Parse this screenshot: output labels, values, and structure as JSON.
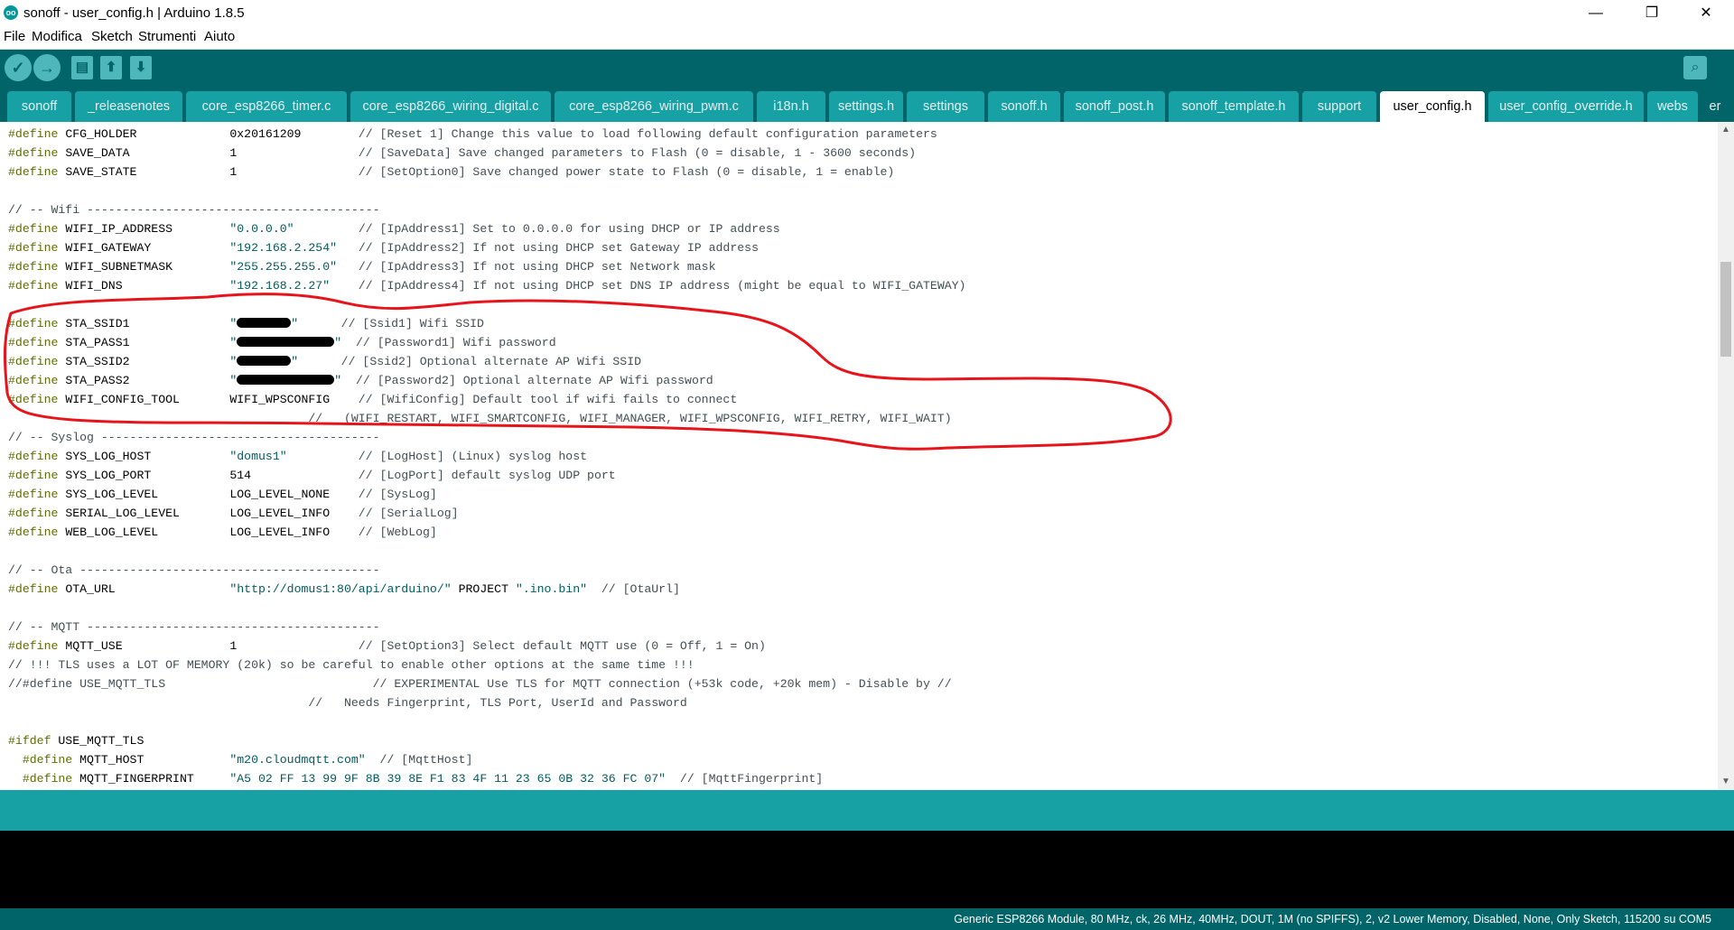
{
  "window": {
    "title": "sonoff - user_config.h | Arduino 1.8.5",
    "app_icon_glyph": "oo",
    "minimize": "—",
    "maximize": "❐",
    "close": "✕"
  },
  "menu": [
    "File",
    "Modifica",
    "Sketch",
    "Strumenti",
    "Aiuto"
  ],
  "toolbar": {
    "verify_icon": "✓",
    "upload_icon": "→",
    "new_icon": "▤",
    "open_icon": "⬆",
    "save_icon": "⬇",
    "serial_icon": "⌕"
  },
  "tabs": [
    "sonoff",
    "_releasenotes",
    "core_esp8266_timer.c",
    "core_esp8266_wiring_digital.c",
    "core_esp8266_wiring_pwm.c",
    "i18n.h",
    "settings.h",
    "settings",
    "sonoff.h",
    "sonoff_post.h",
    "sonoff_template.h",
    "support",
    "user_config.h",
    "user_config_override.h",
    "webs",
    "er"
  ],
  "active_tab": "user_config.h",
  "code_lines": [
    [
      [
        "kw",
        "#define"
      ],
      [
        "t",
        " CFG_HOLDER             0x20161209        "
      ],
      [
        "cm",
        "// [Reset 1] Change this value to load following default configuration parameters"
      ]
    ],
    [
      [
        "kw",
        "#define"
      ],
      [
        "t",
        " SAVE_DATA              1                 "
      ],
      [
        "cm",
        "// [SaveData] Save changed parameters to Flash (0 = disable, 1 - 3600 seconds)"
      ]
    ],
    [
      [
        "kw",
        "#define"
      ],
      [
        "t",
        " SAVE_STATE             1                 "
      ],
      [
        "cm",
        "// [SetOption0] Save changed power state to Flash (0 = disable, 1 = enable)"
      ]
    ],
    [],
    [
      [
        "cm",
        "// -- Wifi -----------------------------------------"
      ]
    ],
    [
      [
        "kw",
        "#define"
      ],
      [
        "t",
        " WIFI_IP_ADDRESS        "
      ],
      [
        "str",
        "\"0.0.0.0\""
      ],
      [
        "t",
        "         "
      ],
      [
        "cm",
        "// [IpAddress1] Set to 0.0.0.0 for using DHCP or IP address"
      ]
    ],
    [
      [
        "kw",
        "#define"
      ],
      [
        "t",
        " WIFI_GATEWAY           "
      ],
      [
        "str",
        "\"192.168.2.254\""
      ],
      [
        "t",
        "   "
      ],
      [
        "cm",
        "// [IpAddress2] If not using DHCP set Gateway IP address"
      ]
    ],
    [
      [
        "kw",
        "#define"
      ],
      [
        "t",
        " WIFI_SUBNETMASK        "
      ],
      [
        "str",
        "\"255.255.255.0\""
      ],
      [
        "t",
        "   "
      ],
      [
        "cm",
        "// [IpAddress3] If not using DHCP set Network mask"
      ]
    ],
    [
      [
        "kw",
        "#define"
      ],
      [
        "t",
        " WIFI_DNS               "
      ],
      [
        "str",
        "\"192.168.2.27\""
      ],
      [
        "t",
        "    "
      ],
      [
        "cm",
        "// [IpAddress4] If not using DHCP set DNS IP address (might be equal to WIFI_GATEWAY)"
      ]
    ],
    [],
    [
      [
        "kw",
        "#define"
      ],
      [
        "t",
        " STA_SSID1              "
      ],
      [
        "str",
        "\""
      ],
      [
        "r",
        "60"
      ],
      [
        "str",
        "\""
      ],
      [
        "t",
        "      "
      ],
      [
        "cm",
        "// [Ssid1] Wifi SSID"
      ]
    ],
    [
      [
        "kw",
        "#define"
      ],
      [
        "t",
        " STA_PASS1              "
      ],
      [
        "str",
        "\""
      ],
      [
        "r",
        "108"
      ],
      [
        "str",
        "\""
      ],
      [
        "t",
        "  "
      ],
      [
        "cm",
        "// [Password1] Wifi password"
      ]
    ],
    [
      [
        "kw",
        "#define"
      ],
      [
        "t",
        " STA_SSID2              "
      ],
      [
        "str",
        "\""
      ],
      [
        "r",
        "60"
      ],
      [
        "str",
        "\""
      ],
      [
        "t",
        "      "
      ],
      [
        "cm",
        "// [Ssid2] Optional alternate AP Wifi SSID"
      ]
    ],
    [
      [
        "kw",
        "#define"
      ],
      [
        "t",
        " STA_PASS2              "
      ],
      [
        "str",
        "\""
      ],
      [
        "r",
        "108"
      ],
      [
        "str",
        "\""
      ],
      [
        "t",
        "  "
      ],
      [
        "cm",
        "// [Password2] Optional alternate AP Wifi password"
      ]
    ],
    [
      [
        "kw",
        "#define"
      ],
      [
        "t",
        " WIFI_CONFIG_TOOL       WIFI_WPSCONFIG    "
      ],
      [
        "cm",
        "// [WifiConfig] Default tool if wifi fails to connect"
      ]
    ],
    [
      [
        "t",
        "                                          "
      ],
      [
        "cm",
        "//   (WIFI_RESTART, WIFI_SMARTCONFIG, WIFI_MANAGER, WIFI_WPSCONFIG, WIFI_RETRY, WIFI_WAIT)"
      ]
    ],
    [
      [
        "cm",
        "// -- Syslog ---------------------------------------"
      ]
    ],
    [
      [
        "kw",
        "#define"
      ],
      [
        "t",
        " SYS_LOG_HOST           "
      ],
      [
        "str",
        "\"domus1\""
      ],
      [
        "t",
        "          "
      ],
      [
        "cm",
        "// [LogHost] (Linux) syslog host"
      ]
    ],
    [
      [
        "kw",
        "#define"
      ],
      [
        "t",
        " SYS_LOG_PORT           514               "
      ],
      [
        "cm",
        "// [LogPort] default syslog UDP port"
      ]
    ],
    [
      [
        "kw",
        "#define"
      ],
      [
        "t",
        " SYS_LOG_LEVEL          LOG_LEVEL_NONE    "
      ],
      [
        "cm",
        "// [SysLog]"
      ]
    ],
    [
      [
        "kw",
        "#define"
      ],
      [
        "t",
        " SERIAL_LOG_LEVEL       LOG_LEVEL_INFO    "
      ],
      [
        "cm",
        "// [SerialLog]"
      ]
    ],
    [
      [
        "kw",
        "#define"
      ],
      [
        "t",
        " WEB_LOG_LEVEL          LOG_LEVEL_INFO    "
      ],
      [
        "cm",
        "// [WebLog]"
      ]
    ],
    [],
    [
      [
        "cm",
        "// -- Ota ------------------------------------------"
      ]
    ],
    [
      [
        "kw",
        "#define"
      ],
      [
        "t",
        " OTA_URL                "
      ],
      [
        "str",
        "\"http://domus1:80/api/arduino/\""
      ],
      [
        "t",
        " PROJECT "
      ],
      [
        "str",
        "\".ino.bin\""
      ],
      [
        "t",
        "  "
      ],
      [
        "cm",
        "// [OtaUrl]"
      ]
    ],
    [],
    [
      [
        "cm",
        "// -- MQTT -----------------------------------------"
      ]
    ],
    [
      [
        "kw",
        "#define"
      ],
      [
        "t",
        " MQTT_USE               1                 "
      ],
      [
        "cm",
        "// [SetOption3] Select default MQTT use (0 = Off, 1 = On)"
      ]
    ],
    [
      [
        "cm",
        "// !!! TLS uses a LOT OF MEMORY (20k) so be careful to enable other options at the same time !!!"
      ]
    ],
    [
      [
        "cm",
        "//#define USE_MQTT_TLS                             // EXPERIMENTAL Use TLS for MQTT connection (+53k code, +20k mem) - Disable by //"
      ]
    ],
    [
      [
        "t",
        "                                          "
      ],
      [
        "cm",
        "//   Needs Fingerprint, TLS Port, UserId and Password"
      ]
    ],
    [],
    [
      [
        "kw",
        "#ifdef"
      ],
      [
        "t",
        " USE_MQTT_TLS"
      ]
    ],
    [
      [
        "t",
        "  "
      ],
      [
        "kw",
        "#define"
      ],
      [
        "t",
        " MQTT_HOST            "
      ],
      [
        "str",
        "\"m20.cloudmqtt.com\""
      ],
      [
        "t",
        "  "
      ],
      [
        "cm",
        "// [MqttHost]"
      ]
    ],
    [
      [
        "t",
        "  "
      ],
      [
        "kw",
        "#define"
      ],
      [
        "t",
        " MQTT_FINGERPRINT     "
      ],
      [
        "str",
        "\"A5 02 FF 13 99 9F 8B 39 8E F1 83 4F 11 23 65 0B 32 36 FC 07\""
      ],
      [
        "t",
        "  "
      ],
      [
        "cm",
        "// [MqttFingerprint]"
      ]
    ]
  ],
  "scroll": {
    "up": "▲",
    "down": "▼"
  },
  "status": {
    "board_info": "Generic ESP8266 Module, 80 MHz, ck, 26 MHz, 40MHz, DOUT, 1M (no SPIFFS), 2, v2 Lower Memory, Disabled, None, Only Sketch, 115200 su COM5"
  },
  "colors": {
    "toolbar": "#006468",
    "tab": "#17a1a5",
    "annotation": "#e8141b"
  }
}
